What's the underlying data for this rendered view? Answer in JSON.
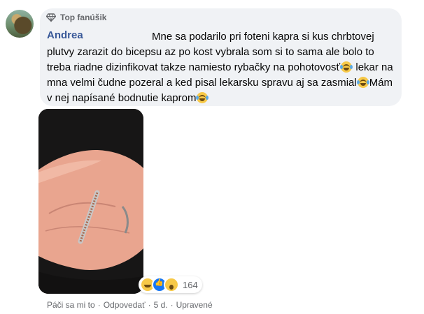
{
  "comment": {
    "badge": "Top fanúšik",
    "author": "Andrea",
    "text_parts": [
      "Mne sa podarilo pri foteni kapra si kus chrbtovej plutvy zarazit do bicepsu az po kost vybrala som si to sama ale bolo to treba riadne dizinfikovat takze namiesto rybačky na pohotovosť",
      " lekar na mna velmi čudne pozeral a ked pisal lekarsku spravu aj sa zasmial",
      "Mám v nej napísané bodnutie kaprom"
    ],
    "emoji": "crying-laughing-emoji",
    "reactions": {
      "icons": [
        "haha-icon",
        "like-icon",
        "wow-icon"
      ],
      "count": "164"
    },
    "actions": {
      "like": "Páči sa mi to",
      "reply": "Odpovedať",
      "time": "5 d.",
      "edited": "Upravené",
      "separator": "·"
    }
  },
  "colors": {
    "author": "#385898",
    "bubble": "#f0f2f5",
    "meta": "#65676b",
    "like": "#1877f2"
  }
}
